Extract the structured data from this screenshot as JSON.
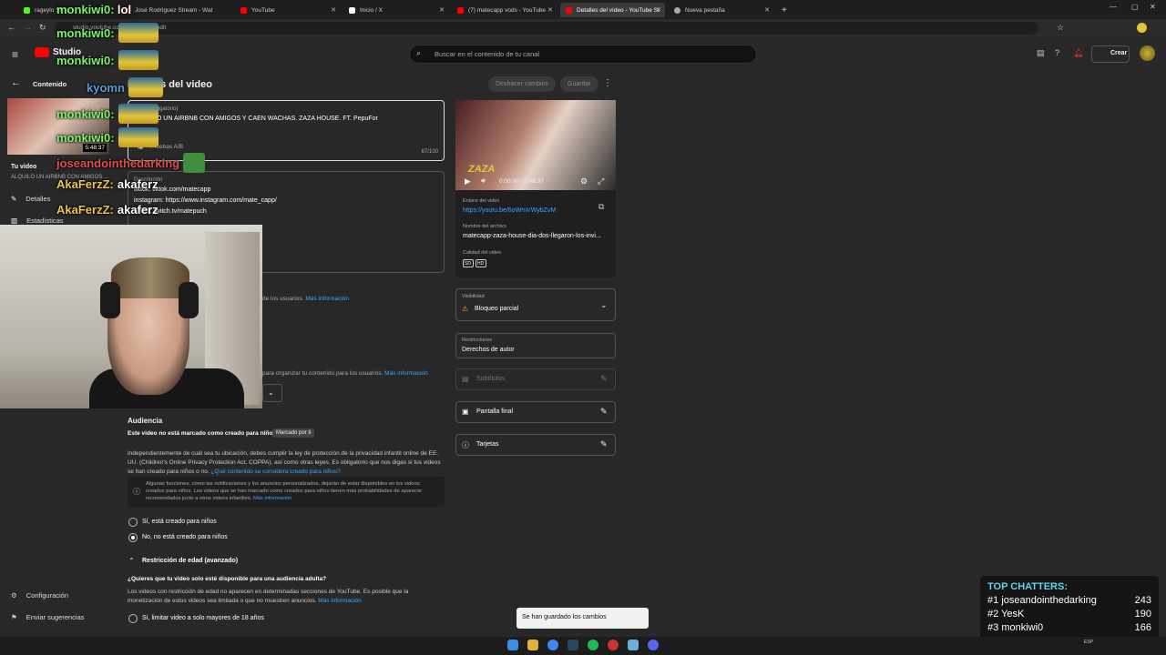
{
  "browser": {
    "tabs": [
      {
        "title": "rageylo St",
        "color": "#53fc18"
      },
      {
        "title": "José Rodríguez Stream - Wat",
        "color": "#ff0000"
      },
      {
        "title": "YouTube",
        "color": "#ff0000"
      },
      {
        "title": "Inicio / X",
        "color": "#ffffff"
      },
      {
        "title": "(7) matecapp vods - YouTube",
        "color": "#ff0000"
      },
      {
        "title": "Detalles del vídeo - YouTube St",
        "color": "#ff0000"
      },
      {
        "title": "Nueva pestaña",
        "color": "#aaaaaa"
      }
    ],
    "url": "studio.youtube.com/video/6o...//edit"
  },
  "header": {
    "logo": "Studio",
    "search_placeholder": "Buscar en el contenido de tu canal",
    "create_label": "Crear"
  },
  "sidebar": {
    "back_label": "Contenido",
    "duration": "5:48:37",
    "your_video": "Tu video",
    "video_title_short": "ALQUILO UN AIRBNB CON AMIGOS ...",
    "items": [
      {
        "label": "Detalles",
        "icon": "pencil-icon"
      },
      {
        "label": "Estadísticas",
        "icon": "analytics-icon"
      }
    ],
    "bottom": [
      {
        "label": "Configuración",
        "icon": "gear-icon"
      },
      {
        "label": "Enviar sugerencias",
        "icon": "feedback-icon"
      }
    ]
  },
  "page": {
    "heading": "Detalles del video",
    "undo_label": "Deshacer cambios",
    "save_label": "Guardar",
    "title_field": {
      "label": "Título (obligatorio)",
      "value": "ALQUILO UN AIRBNB CON AMIGOS Y CAEN WACHAS. ZAZA HOUSE. FT. PepuFor",
      "count": "67/100",
      "test": "Pruebas A/B"
    },
    "description": {
      "label": "Descripción",
      "lines": [
        "tiktok: tiktok.com/matecapp",
        "instagram: https://www.instagram.com/mate_capp/",
        "twitch: twitch.tv/matepuch"
      ]
    },
    "thumb_note": "de los usuarios.",
    "thumb_link": "Más información",
    "playlist_note": "para organizar tu contenido para los usuarios.",
    "playlist_link": "Más información",
    "audience": {
      "title": "Audiencia",
      "status": "Este video no está marcado como creado para niños",
      "badge": "Marcado por ti",
      "body": "Independientemente de cuál sea tu ubicación, debes cumplir la ley de protección de la privacidad infantil online de EE. UU. (Children's Online Privacy Protection Act, COPPA), así como otras leyes. Es obligatorio que nos digas si tus videos se han creado para niños o no.",
      "body_link": "¿Qué contenido se considera creado para niños?",
      "info": "Algunas funciones, como las notificaciones y los anuncios personalizados, dejarán de estar disponibles en los videos creados para niños. Los videos que se han marcado como creados para niños tienen más probabilidades de aparecer recomendados junto a otros videos infantiles.",
      "info_link": "Más información",
      "opt_yes": "Sí, está creado para niños",
      "opt_no": "No, no está creado para niños"
    },
    "age": {
      "title": "Restricción de edad (avanzado)",
      "question": "¿Quieres que tu video solo esté disponible para una audiencia adulta?",
      "body": "Los videos con restricción de edad no aparecen en determinadas secciones de YouTube. Es posible que la monetización de estos videos sea limitada o que no muestren anuncios.",
      "link": "Más información",
      "opt_yes": "Sí, limitar video a solo mayores de 18 años"
    }
  },
  "right": {
    "player_time": "0:00:00 / 5:48:37",
    "overlay_text": "ZAZA",
    "link_label": "Enlace del video",
    "link_value": "https://youtu.be/6oWmVWybZvM",
    "file_label": "Nombre del archivo",
    "file_value": "matecapp-zaza-house-dia-dos-llegaron-los-invi...",
    "quality_label": "Calidad del video",
    "visibility_label": "Visibilidad",
    "visibility_value": "Bloqueo parcial",
    "restrictions_label": "Restricciones",
    "restrictions_value": "Derechos de autor",
    "subtitles": "Subtítulos",
    "endscreen": "Pantalla final",
    "cards": "Tarjetas"
  },
  "overlay": {
    "chat": [
      {
        "user": "monkiwi0:",
        "msg": "lol",
        "color": "#7cf266"
      },
      {
        "user": "monkiwi0:",
        "msg": "",
        "color": "#7cf266"
      },
      {
        "user": "monkiwi0:",
        "msg": "",
        "color": "#7cf266"
      },
      {
        "user": "kyomn",
        "msg": "",
        "color": "#5b9bd5"
      },
      {
        "user": "monkiwi0:",
        "msg": "",
        "color": "#7cf266"
      },
      {
        "user": "monkiwi0:",
        "msg": "",
        "color": "#7cf266"
      },
      {
        "user": "joseandointhedarking",
        "msg": "",
        "color": "#e24b4b"
      },
      {
        "user": "AkaFerzZ:",
        "msg": "akaferz",
        "color": "#e8c449"
      },
      {
        "user": "AkaFerzZ:",
        "msg": "akaferz",
        "color": "#e8c449"
      }
    ],
    "top_chatters_title": "TOP CHATTERS:",
    "top_chatters": [
      {
        "rank": "#1",
        "name": "joseandointhedarking",
        "count": "243"
      },
      {
        "rank": "#2",
        "name": "YesK",
        "count": "190"
      },
      {
        "rank": "#3",
        "name": "monkiwi0",
        "count": "166"
      }
    ]
  },
  "toast": "Se han guardado los cambios",
  "taskbar": {
    "lang": "ESP"
  }
}
